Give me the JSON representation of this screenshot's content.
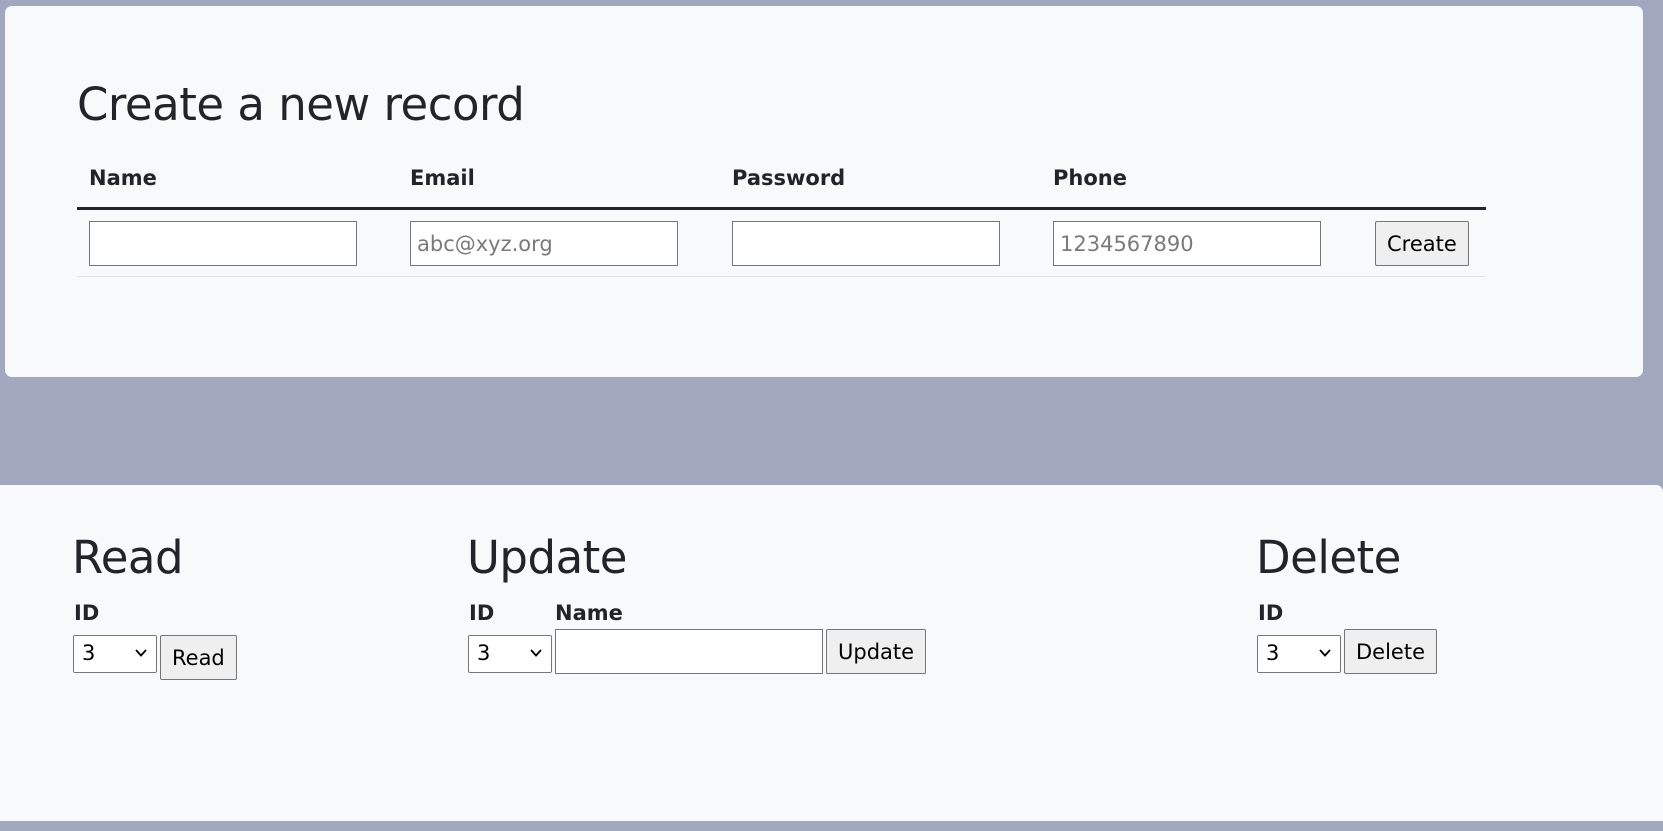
{
  "create": {
    "title": "Create a new record",
    "columns": [
      "Name",
      "Email",
      "Password",
      "Phone"
    ],
    "fields": {
      "name": {
        "value": "",
        "placeholder": ""
      },
      "email": {
        "value": "",
        "placeholder": "abc@xyz.org"
      },
      "password": {
        "value": "",
        "placeholder": ""
      },
      "phone": {
        "value": "",
        "placeholder": "1234567890"
      }
    },
    "button_label": "Create"
  },
  "read": {
    "title": "Read",
    "id_label": "ID",
    "id_selected": "3",
    "button_label": "Read"
  },
  "update": {
    "title": "Update",
    "id_label": "ID",
    "name_label": "Name",
    "id_selected": "3",
    "name_value": "",
    "button_label": "Update"
  },
  "delete": {
    "title": "Delete",
    "id_label": "ID",
    "id_selected": "3",
    "button_label": "Delete"
  },
  "colors": {
    "page_background": "#a2a8bd",
    "card_background": "#f8f9fa",
    "text": "#212529"
  }
}
